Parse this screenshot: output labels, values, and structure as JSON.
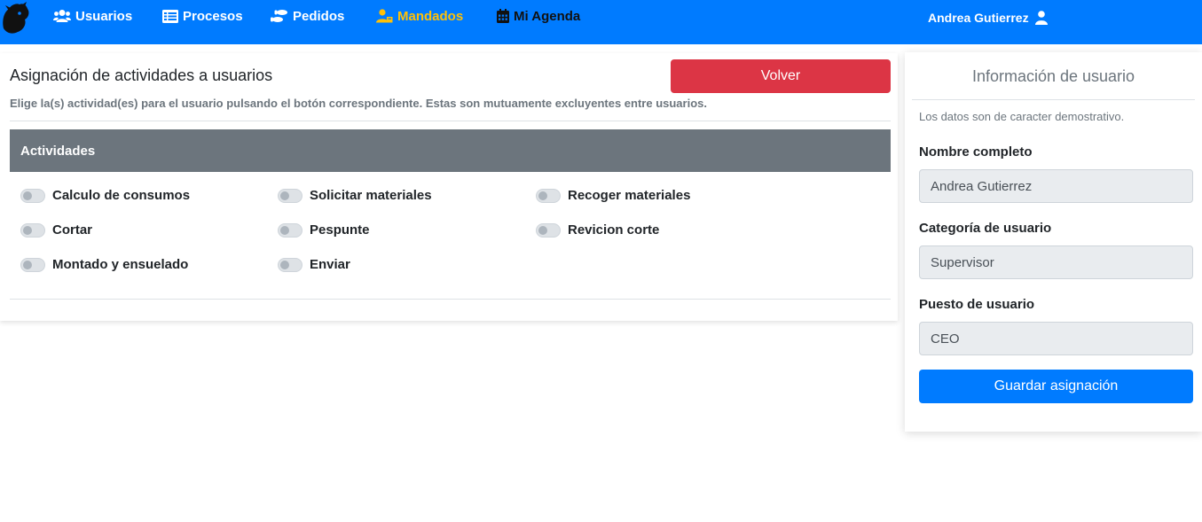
{
  "navbar": {
    "brand_color": "#007bff",
    "active_color": "#ffc107",
    "items": [
      {
        "label": "Usuarios",
        "icon": "users-icon"
      },
      {
        "label": "Procesos",
        "icon": "list-icon"
      },
      {
        "label": "Pedidos",
        "icon": "shoe-prints-icon"
      },
      {
        "label": "Mandados",
        "icon": "user-tie-icon",
        "active": true
      },
      {
        "label": "Mi Agenda",
        "icon": "calendar-icon"
      }
    ],
    "user": {
      "name": "Andrea Gutierrez",
      "icon": "user-icon"
    }
  },
  "main": {
    "title": "Asignación de actividades a usuarios",
    "subtitle": "Elige la(s) actividad(es) para el usuario pulsando el botón correspondiente. Estas son mutuamente excluyentes entre usuarios.",
    "back_button": "Volver",
    "activities_header": "Actividades",
    "activities": [
      {
        "label": "Calculo de consumos",
        "checked": false
      },
      {
        "label": "Solicitar materiales",
        "checked": false
      },
      {
        "label": "Recoger materiales",
        "checked": false
      },
      {
        "label": "Cortar",
        "checked": false
      },
      {
        "label": "Pespunte",
        "checked": false
      },
      {
        "label": "Revicion corte",
        "checked": false
      },
      {
        "label": "Montado y ensuelado",
        "checked": false
      },
      {
        "label": "Enviar",
        "checked": false
      }
    ]
  },
  "side": {
    "title": "Información de usuario",
    "note": "Los datos son de caracter demostrativo.",
    "fields": [
      {
        "label": "Nombre completo",
        "value": "Andrea Gutierrez"
      },
      {
        "label": "Categoría de usuario",
        "value": "Supervisor"
      },
      {
        "label": "Puesto de usuario",
        "value": "CEO"
      }
    ],
    "save_button": "Guardar asignación"
  }
}
